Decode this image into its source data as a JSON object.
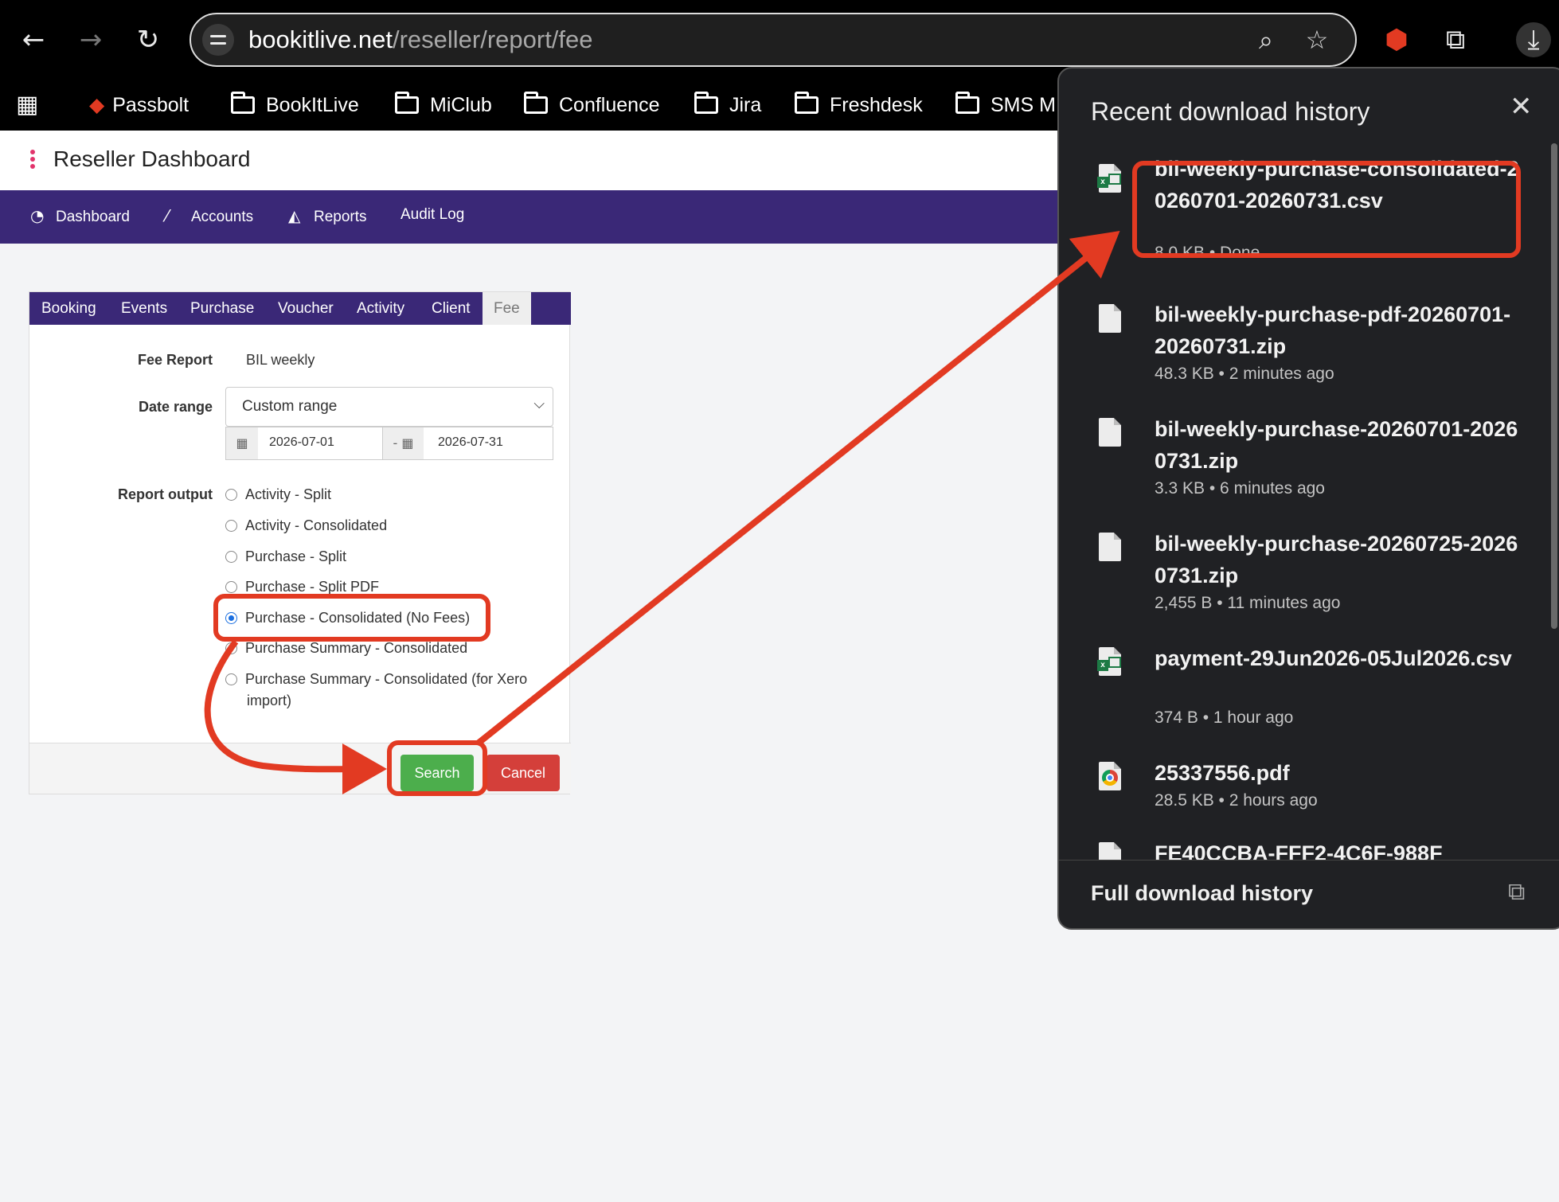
{
  "browser": {
    "url_host": "bookitlive.net",
    "url_path": "/reseller/report/fee",
    "bookmarks": [
      "Passbolt",
      "BookItLive",
      "MiClub",
      "Confluence",
      "Jira",
      "Freshdesk",
      "SMS M"
    ]
  },
  "app": {
    "title": "Reseller Dashboard",
    "nav": [
      "Dashboard",
      "Accounts",
      "Reports",
      "Audit Log"
    ]
  },
  "report": {
    "tabs": [
      "Booking",
      "Events",
      "Purchase",
      "Voucher",
      "Activity",
      "Client",
      "Fee"
    ],
    "active_tab": "Fee",
    "fee_report_label": "Fee Report",
    "fee_report_value": "BIL weekly",
    "date_range_label": "Date range",
    "date_range_value": "Custom range",
    "date_from": "2026-07-01",
    "date_sep": "-",
    "date_to": "2026-07-31",
    "output_label": "Report output",
    "outputs": [
      "Activity - Split",
      "Activity - Consolidated",
      "Purchase - Split",
      "Purchase - Split PDF",
      "Purchase - Consolidated (No Fees)",
      "Purchase Summary - Consolidated",
      "Purchase Summary - Consolidated (for Xero",
      "import)"
    ],
    "selected_output": "Purchase - Consolidated (No Fees)",
    "search_label": "Search",
    "cancel_label": "Cancel"
  },
  "downloads": {
    "title": "Recent download history",
    "items": [
      {
        "name": "bil-weekly-purchase-consolidated-20260701-20260731.csv",
        "meta": "8.0 KB • Done",
        "icon": "excel-icon"
      },
      {
        "name": "bil-weekly-purchase-pdf-20260701-20260731.zip",
        "meta": "48.3 KB • 2 minutes ago",
        "icon": "file-icon"
      },
      {
        "name": "bil-weekly-purchase-20260701-20260731.zip",
        "meta": "3.3 KB • 6 minutes ago",
        "icon": "file-icon"
      },
      {
        "name": "bil-weekly-purchase-20260725-20260731.zip",
        "meta": "2,455 B • 11 minutes ago",
        "icon": "file-icon"
      },
      {
        "name": "payment-29Jun2026-05Jul2026.csv",
        "meta": "374 B • 1 hour ago",
        "icon": "excel-icon"
      },
      {
        "name": "25337556.pdf",
        "meta": "28.5 KB • 2 hours ago",
        "icon": "chrome-icon"
      },
      {
        "name": "FE40CCBA-FFF2-4C6F-988F",
        "meta": "",
        "icon": "file-icon"
      }
    ],
    "footer": "Full download history"
  },
  "colors": {
    "nav_bg": "#3a2877",
    "annotation": "#e23a22",
    "search_btn": "#4cae4c",
    "cancel_btn": "#d43f3a"
  }
}
